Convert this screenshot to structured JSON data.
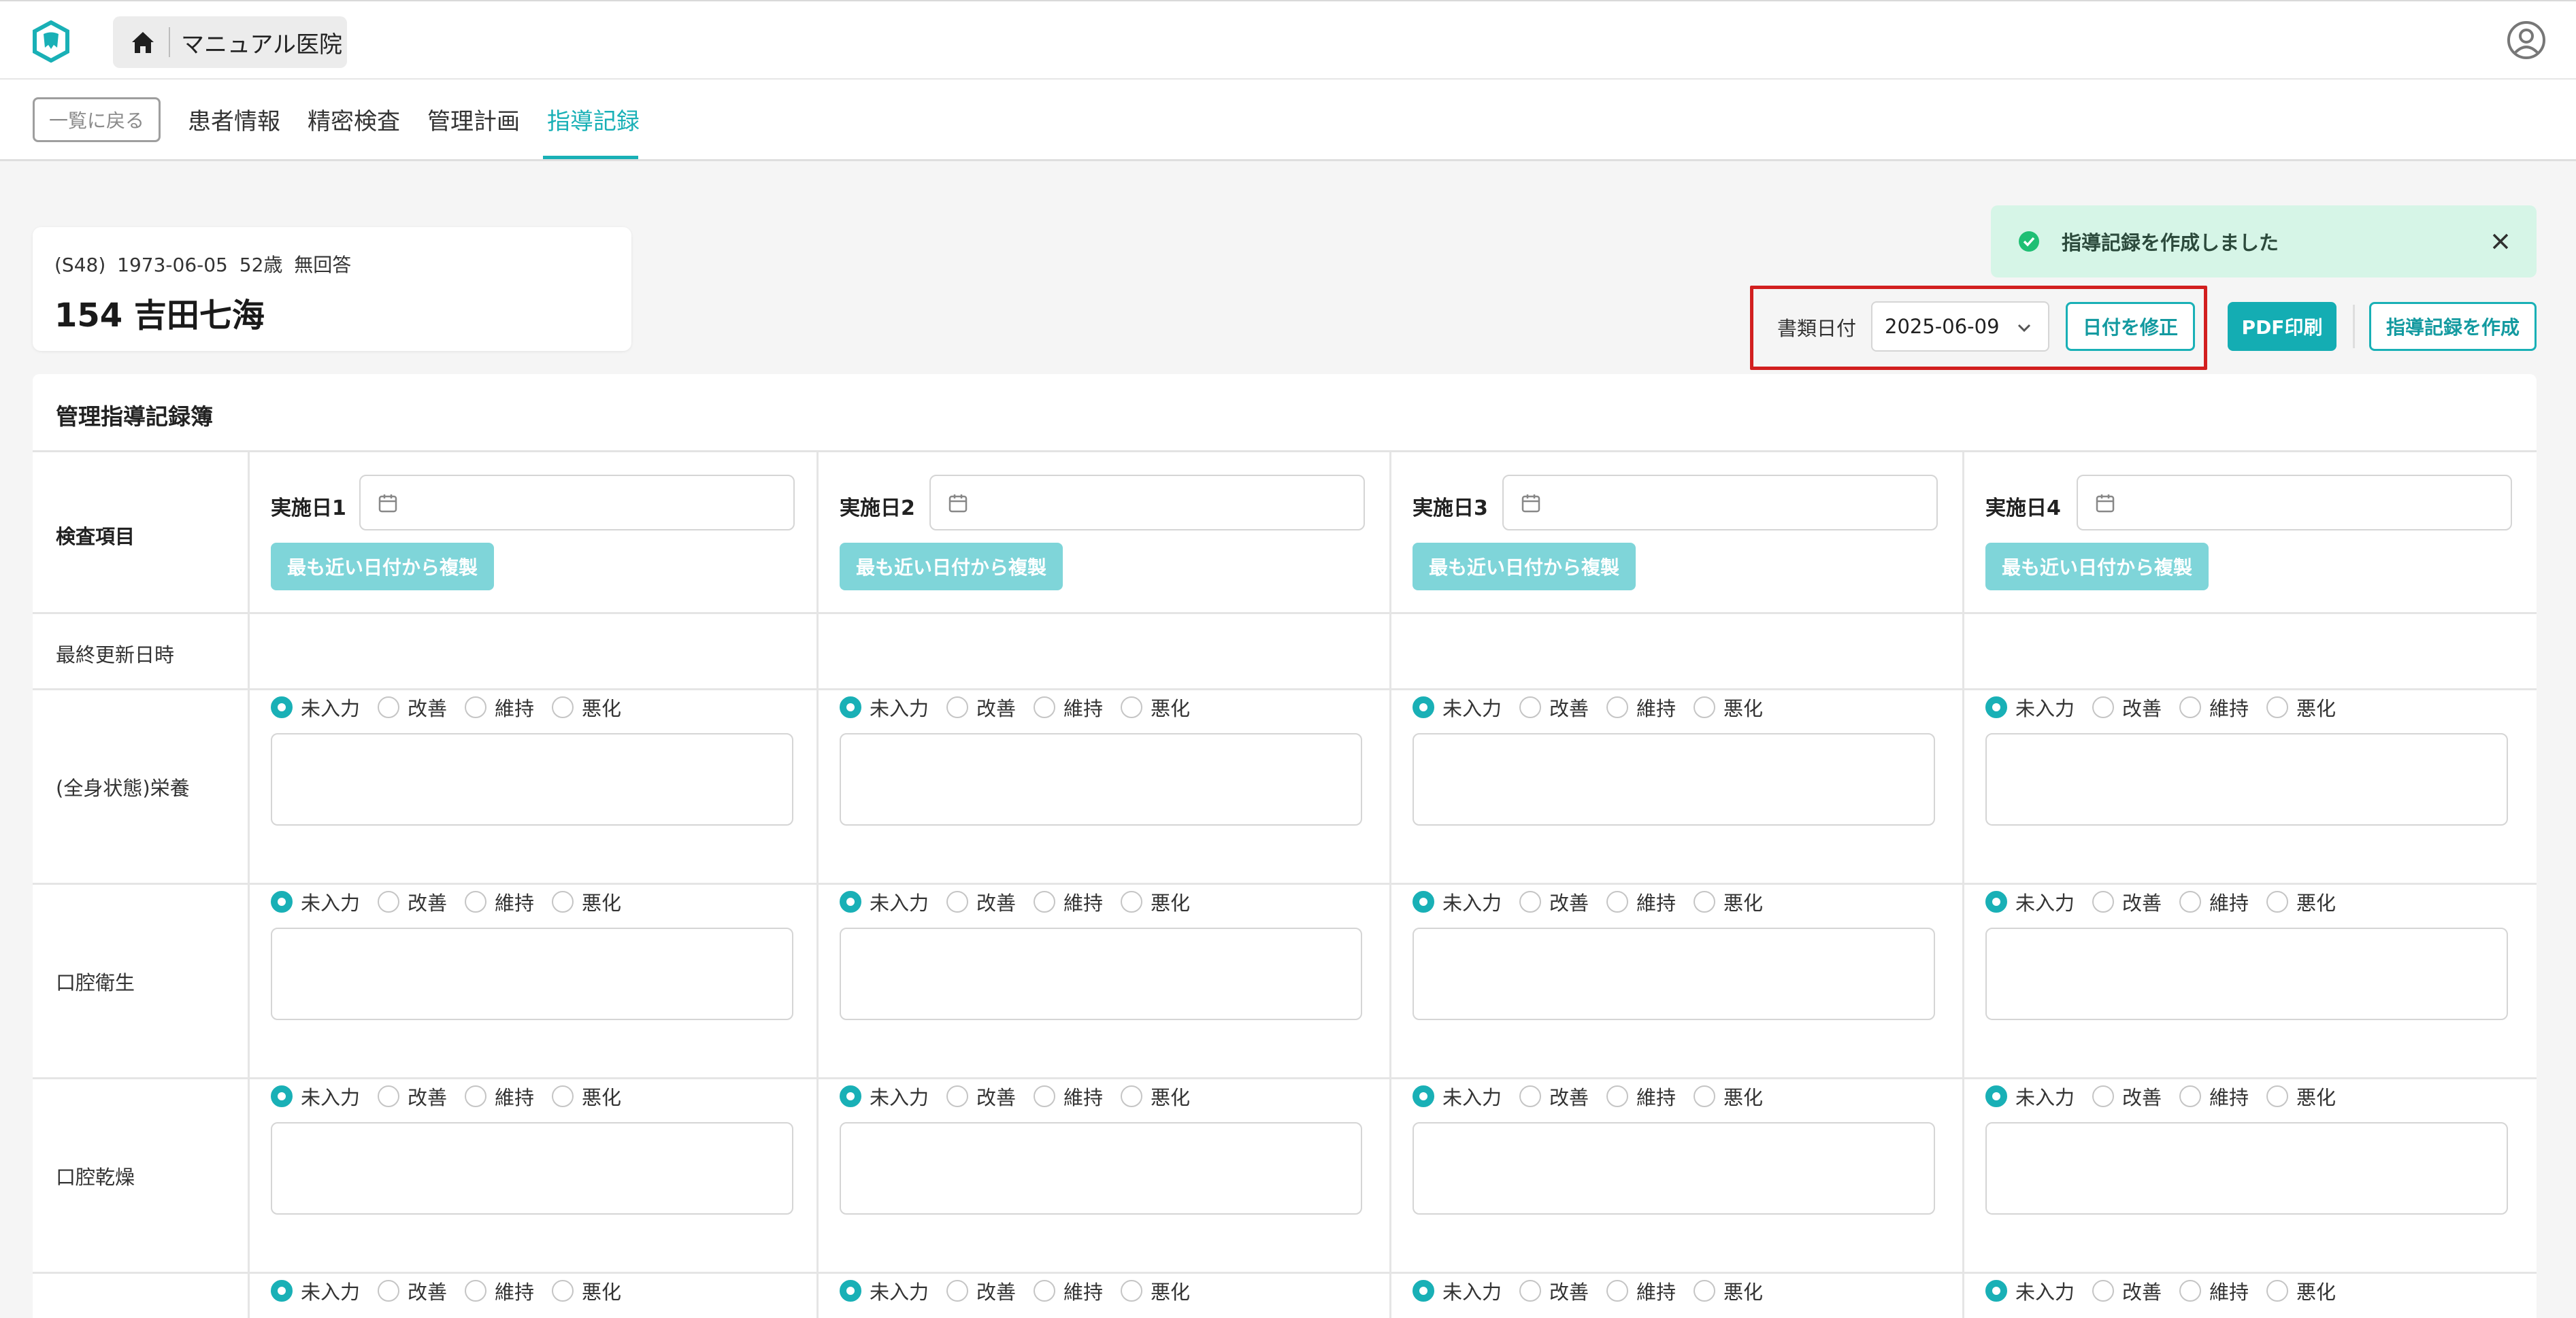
{
  "header": {
    "clinic_name": "マニュアル医院",
    "icons": {
      "logo": "tooth-logo-icon",
      "home": "home-icon",
      "user": "user-circle-icon"
    }
  },
  "nav": {
    "back_label": "一覧に戻る",
    "tabs": [
      {
        "label": "患者情報"
      },
      {
        "label": "精密検査"
      },
      {
        "label": "管理計画"
      },
      {
        "label": "指導記録",
        "active": true
      }
    ]
  },
  "patient": {
    "meta": "(S48) 1973-06-05   52歳   無回答",
    "name": "154  吉田七海"
  },
  "toast": {
    "message": "指導記録を作成しました",
    "color": "#d6f5e7"
  },
  "actions": {
    "doc_date_label": "書類日付",
    "doc_date_value": "2025-06-09",
    "fix_date_label": "日付を修正",
    "pdf_label": "PDF印刷",
    "create_label": "指導記録を作成"
  },
  "book": {
    "title": "管理指導記録簿",
    "header_row_label": "検査項目",
    "last_updated_label": "最終更新日時",
    "days": [
      {
        "label": "実施日1",
        "copy_label": "最も近い日付から複製"
      },
      {
        "label": "実施日2",
        "copy_label": "最も近い日付から複製"
      },
      {
        "label": "実施日3",
        "copy_label": "最も近い日付から複製"
      },
      {
        "label": "実施日4",
        "copy_label": "最も近い日付から複製"
      }
    ],
    "radio_options": [
      "未入力",
      "改善",
      "維持",
      "悪化"
    ],
    "items": [
      {
        "label": "(全身状態)栄養"
      },
      {
        "label": "口腔衛生"
      },
      {
        "label": "口腔乾燥"
      },
      {
        "label": ""
      }
    ]
  },
  "colors": {
    "accent": "#19b0b6",
    "highlight": "#d21f1f"
  }
}
